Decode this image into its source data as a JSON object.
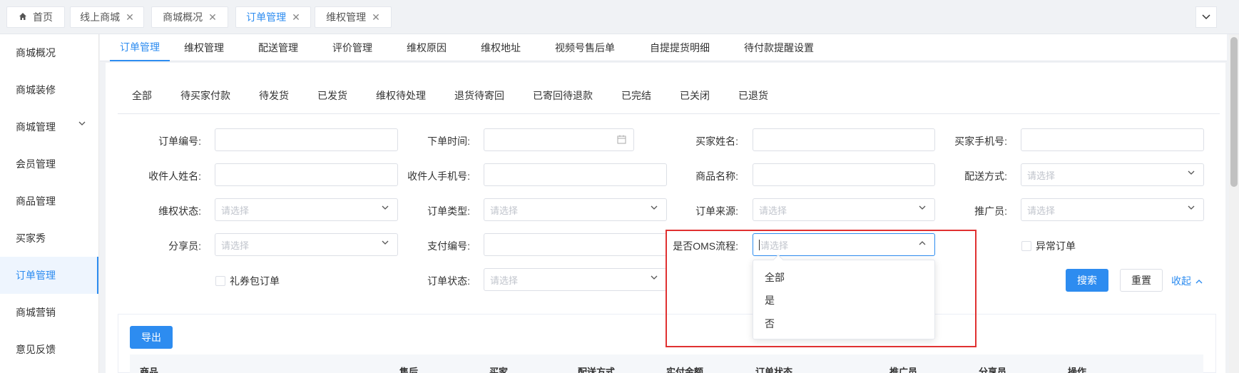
{
  "top_tabs": [
    {
      "label": "首页"
    },
    {
      "label": "线上商城"
    },
    {
      "label": "商城概况"
    },
    {
      "label": "订单管理"
    },
    {
      "label": "维权管理"
    }
  ],
  "sidebar": {
    "items": [
      {
        "label": "商城概况"
      },
      {
        "label": "商城装修"
      },
      {
        "label": "商城管理"
      },
      {
        "label": "会员管理"
      },
      {
        "label": "商品管理"
      },
      {
        "label": "买家秀"
      },
      {
        "label": "订单管理"
      },
      {
        "label": "商城营销"
      },
      {
        "label": "意见反馈"
      }
    ]
  },
  "subnav": [
    {
      "label": "订单管理"
    },
    {
      "label": "维权管理"
    },
    {
      "label": "配送管理"
    },
    {
      "label": "评价管理"
    },
    {
      "label": "维权原因"
    },
    {
      "label": "维权地址"
    },
    {
      "label": "视频号售后单"
    },
    {
      "label": "自提提货明细"
    },
    {
      "label": "待付款提醒设置"
    }
  ],
  "status_tabs": [
    "全部",
    "待买家付款",
    "待发货",
    "已发货",
    "维权待处理",
    "退货待寄回",
    "已寄回待退款",
    "已完结",
    "已关闭",
    "已退货"
  ],
  "form": {
    "order_no": "订单编号:",
    "order_time": "下单时间:",
    "buyer_name": "买家姓名:",
    "buyer_phone": "买家手机号:",
    "receiver_name": "收件人姓名:",
    "receiver_phone": "收件人手机号:",
    "product_name": "商品名称:",
    "delivery_method": "配送方式:",
    "rights_status": "维权状态:",
    "order_type": "订单类型:",
    "order_source": "订单来源:",
    "promoter": "推广员:",
    "sharer": "分享员:",
    "pay_no": "支付编号:",
    "oms_flow": "是否OMS流程:",
    "abnormal_order": "异常订单",
    "gift_order": "礼券包订单",
    "order_status": "订单状态:",
    "placeholder": "请选择"
  },
  "buttons": {
    "search": "搜索",
    "reset": "重置",
    "collapse": "收起",
    "export": "导出"
  },
  "dropdown": {
    "options": [
      "全部",
      "是",
      "否"
    ]
  },
  "table": {
    "headers": [
      "商品",
      "售后",
      "买家",
      "配送方式",
      "实付金额",
      "订单状态",
      "推广员",
      "分享员",
      "操作"
    ]
  },
  "colors": {
    "accent": "#2d8cf0",
    "highlight": "#e03131"
  }
}
